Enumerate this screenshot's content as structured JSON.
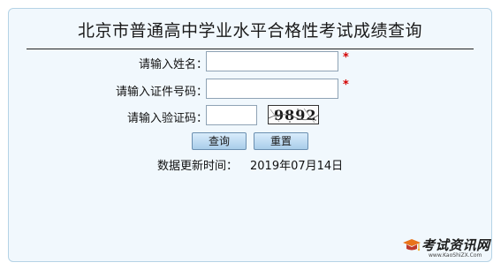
{
  "page": {
    "title": "北京市普通高中学业水平合格性考试成绩查询"
  },
  "form": {
    "name_label": "请输入姓名：",
    "name_value": "",
    "id_label": "请输入证件号码：",
    "id_value": "",
    "captcha_label": "请输入验证码：",
    "captcha_value": "",
    "captcha_image_text": "9892",
    "required_mark": "*"
  },
  "buttons": {
    "query": "查询",
    "reset": "重置"
  },
  "footer": {
    "update_label": "数据更新时间：",
    "update_date": "2019年07月14日"
  },
  "watermark": {
    "site_name": "考试资讯网",
    "site_url": "www.KaoShiZX.Com",
    "icon": "mortarboard-icon"
  },
  "colors": {
    "panel_bg": "#f1f8fd",
    "panel_border": "#b5d3e6",
    "required": "#d40000",
    "button_top": "#d9ecfb",
    "button_bottom": "#a9cdea"
  }
}
